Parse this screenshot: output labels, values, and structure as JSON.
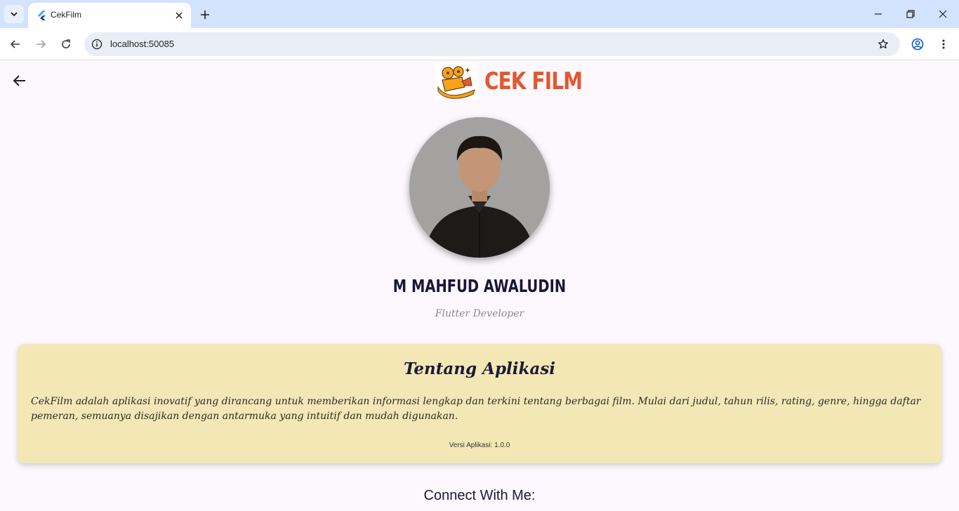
{
  "browser": {
    "tab_title": "CekFilm",
    "url": "localhost:50085"
  },
  "app": {
    "logo_text": "CEK FILM",
    "profile": {
      "name": "M MAHFUD AWALUDIN",
      "role": "Flutter Developer"
    },
    "about": {
      "title": "Tentang Aplikasi",
      "description": "CekFilm adalah aplikasi inovatif yang dirancang untuk memberikan informasi lengkap dan terkini tentang berbagai film. Mulai dari judul, tahun rilis, rating, genre, hingga daftar pemeran, semuanya disajikan dengan antarmuka yang intuitif dan mudah digunakan.",
      "version": "Versi Aplikasi: 1.0.0"
    },
    "connect_label": "Connect With Me:"
  },
  "colors": {
    "tabbar": "#d3e3fd",
    "page_bg": "#fdf7fe",
    "logo_accent": "#e4572e",
    "card_bg": "#f3e8b5",
    "name_text": "#17173a"
  },
  "icons": {
    "tab_menu": "chevron-down-icon",
    "favicon": "flutter-icon",
    "tab_close": "close-icon",
    "new_tab": "plus-icon",
    "back": "arrow-left-icon",
    "forward": "arrow-right-icon",
    "reload": "reload-icon",
    "site_info": "info-icon",
    "bookmark": "star-icon",
    "profile": "account-icon",
    "menu": "more-vert-icon"
  }
}
